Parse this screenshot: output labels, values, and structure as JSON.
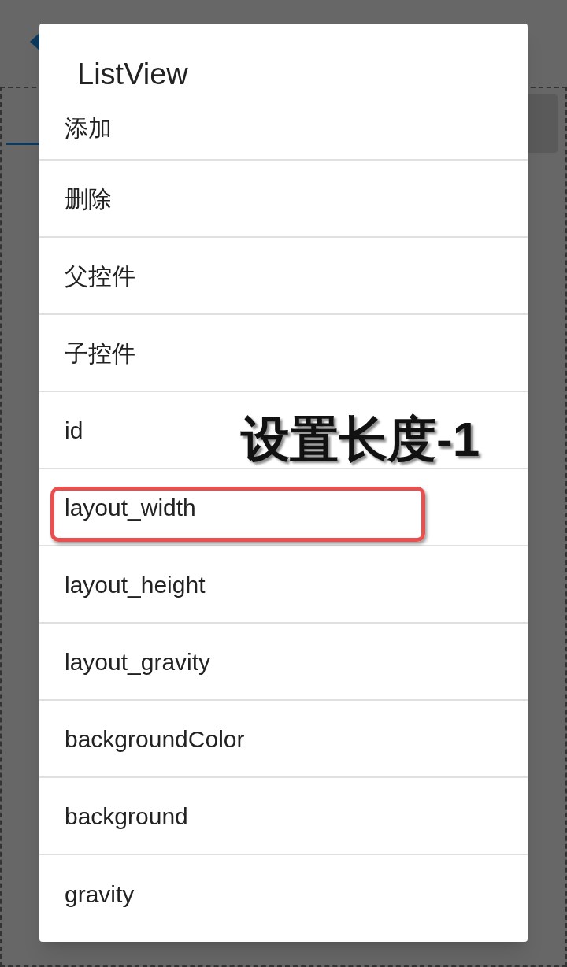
{
  "dialog": {
    "title": "ListView",
    "items": [
      {
        "label": "添加",
        "highlighted": false
      },
      {
        "label": "删除",
        "highlighted": false
      },
      {
        "label": "父控件",
        "highlighted": false
      },
      {
        "label": "子控件",
        "highlighted": false
      },
      {
        "label": "id",
        "highlighted": false
      },
      {
        "label": "layout_width",
        "highlighted": true
      },
      {
        "label": "layout_height",
        "highlighted": false
      },
      {
        "label": "layout_gravity",
        "highlighted": false
      },
      {
        "label": "backgroundColor",
        "highlighted": false
      },
      {
        "label": "background",
        "highlighted": false
      },
      {
        "label": "gravity",
        "highlighted": false
      }
    ]
  },
  "annotation": "设置长度-1"
}
